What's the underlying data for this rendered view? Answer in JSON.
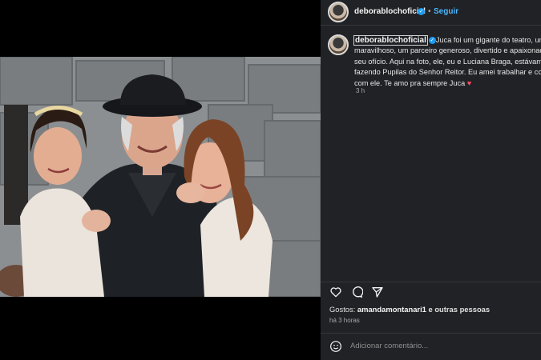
{
  "post": {
    "username": "deborablochoficial",
    "follow_label": "Seguir",
    "separator": "•",
    "caption_lines": [
      "Juca foi um gigante do teatro, um a",
      "maravilhoso, um parceiro generoso, divertido e apaixonad",
      "seu ofício. Aqui na foto, ele, eu e Luciana Braga, estávamo",
      "fazendo Pupilas do Senhor Reitor. Eu amei trabalhar e con",
      "com ele. Te amo pra sempre Juca"
    ],
    "caption_emoji": "♥",
    "caption_time": "3 h",
    "likes_prefix": "Gostos:",
    "likes_user": "amandamontanari1",
    "likes_suffix": "e outras pessoas",
    "post_age": "há 3 horas",
    "comment_placeholder": "Adicionar comentário..."
  },
  "icons": {
    "like": "heart-icon",
    "comment": "comment-icon",
    "share": "send-icon",
    "emoji": "emoji-icon",
    "verified": "verified-badge-icon"
  },
  "colors": {
    "panel_bg": "#202226",
    "link_blue": "#4cb5f9",
    "verified_blue": "#1d9bf0",
    "heart_red": "#ff4d5e"
  }
}
